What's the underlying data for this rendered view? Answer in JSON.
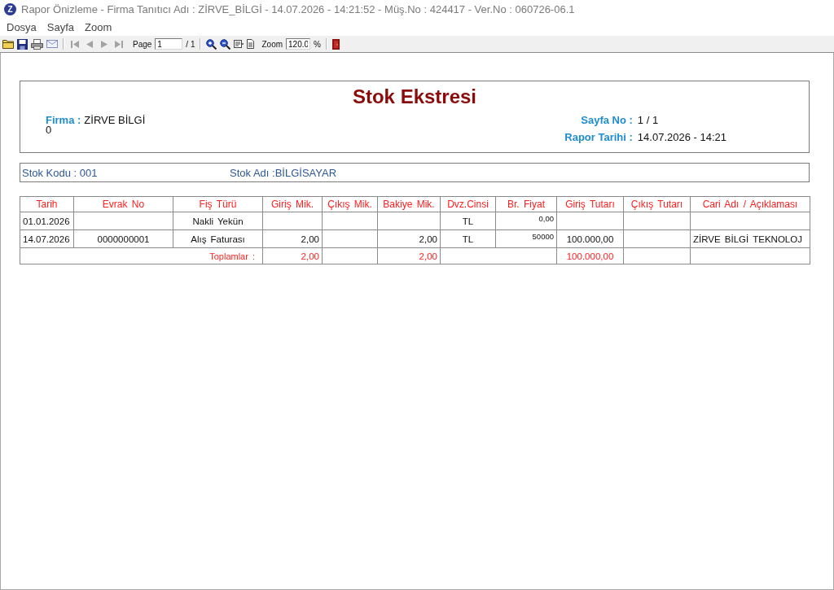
{
  "window": {
    "icon_letter": "Z",
    "title": "Rapor Önizleme - Firma Tanıtıcı Adı : ZİRVE_BİLGİ - 14.07.2026 - 14:21:52 - Müş.No : 424417 - Ver.No : 060726-06.1"
  },
  "menu": [
    "Dosya",
    "Sayfa",
    "Zoom"
  ],
  "toolbar": {
    "nav_buttons": [
      {
        "disabled": true
      },
      {
        "disabled": true
      },
      {
        "disabled": true
      },
      {
        "disabled": true
      }
    ],
    "page_label": "Page",
    "page_value": "1",
    "page_total": "/ 1",
    "zoom_label": "Zoom",
    "zoom_value": "120.0",
    "zoom_unit": "%"
  },
  "report": {
    "title": "Stok Ekstresi",
    "firm": {
      "label": "Firma :",
      "value": "ZİRVE BİLGİ",
      "line_2": "0"
    },
    "page_no": {
      "label": "Sayfa No :",
      "value": "1 / 1"
    },
    "report_date": {
      "label": "Rapor Tarihi :",
      "value": "14.07.2026 - 14:21"
    },
    "stock_code": "Stok Kodu : 001",
    "stock_name": "Stok Adı :BİLGİSAYAR",
    "table": {
      "columns": [
        "Tarih",
        "Evrak No",
        "Fiş Türü",
        "Giriş Mik.",
        "Çıkış Mik.",
        "Bakiye Mik.",
        "Dvz.Cinsi",
        "Br. Fiyat",
        "Giriş Tutarı",
        "Çıkış Tutarı",
        "Cari Adı / Açıklaması"
      ],
      "rows": [
        {
          "tarih": "01.01.2026",
          "fis_turu": "Nakli Yekün",
          "dvz_cinsi": "TL",
          "br_fiyat": "0,00"
        },
        {
          "tarih": "14.07.2026",
          "evrak_no": "0000000001",
          "fis_turu": "Alış Faturası",
          "giris_mik": "2,00",
          "bakiye_mik": "2,00",
          "dvz_cinsi": "TL",
          "br_fiyat": "50000",
          "giris_tutari": "100.000,00",
          "cari_adi_aciklamasi": "ZİRVE BİLGİ TEKNOLOJ"
        }
      ],
      "totals": {
        "label": "Toplamlar :",
        "giris_mik": "2,00",
        "bakiye_mik": "2,00",
        "giris_tutari": "100.000,00"
      }
    }
  }
}
